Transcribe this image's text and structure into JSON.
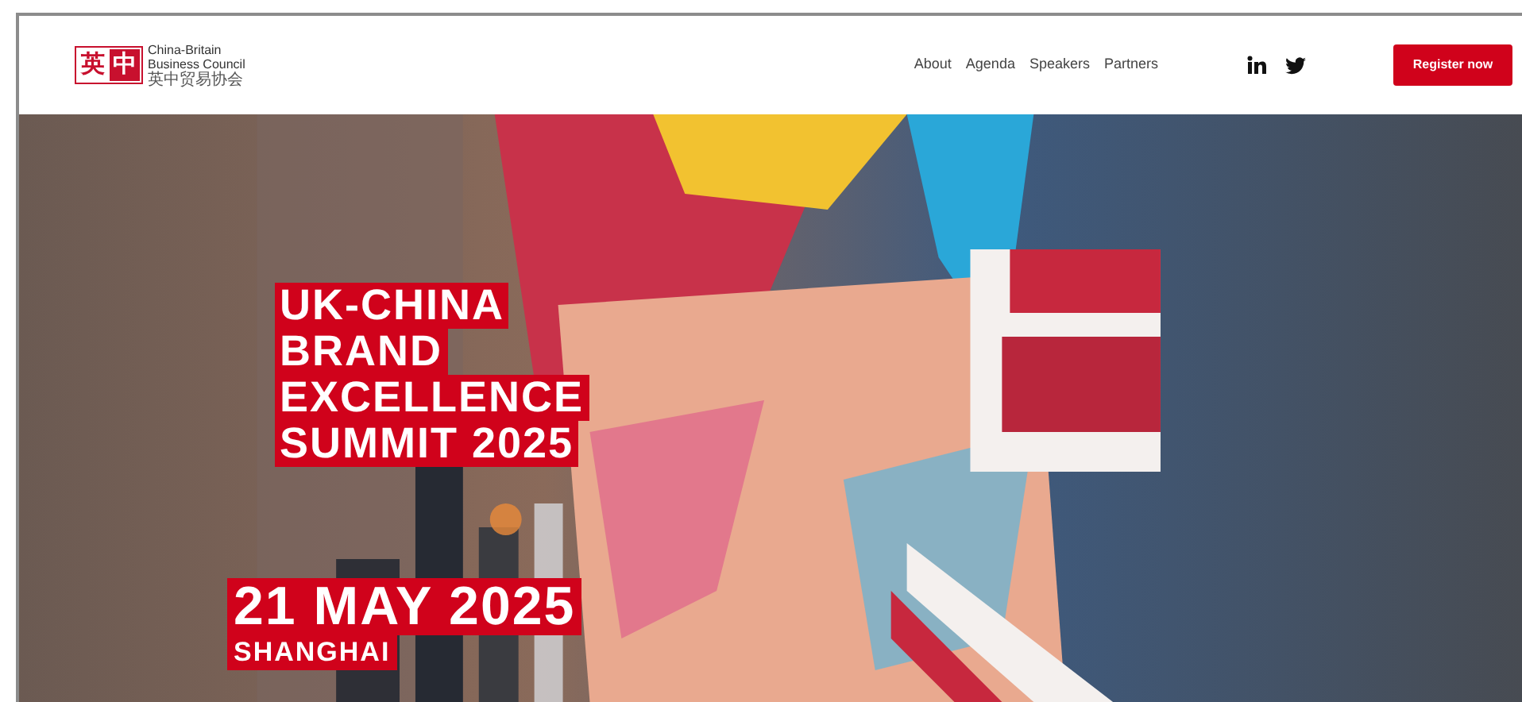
{
  "header": {
    "logo": {
      "glyphs": [
        "英",
        "中"
      ],
      "name_lines": [
        "China-Britain",
        "Business Council"
      ],
      "name_chinese": "英中贸易协会"
    },
    "nav": [
      {
        "label": "About"
      },
      {
        "label": "Agenda"
      },
      {
        "label": "Speakers"
      },
      {
        "label": "Partners"
      }
    ],
    "social": [
      {
        "kind": "linkedin"
      },
      {
        "kind": "twitter"
      }
    ],
    "cta": "Register now"
  },
  "hero": {
    "title_lines": [
      "UK-CHINA",
      "BRAND",
      "EXCELLENCE",
      "SUMMIT 2025"
    ],
    "date": "21 MAY 2025",
    "city": "SHANGHAI"
  }
}
